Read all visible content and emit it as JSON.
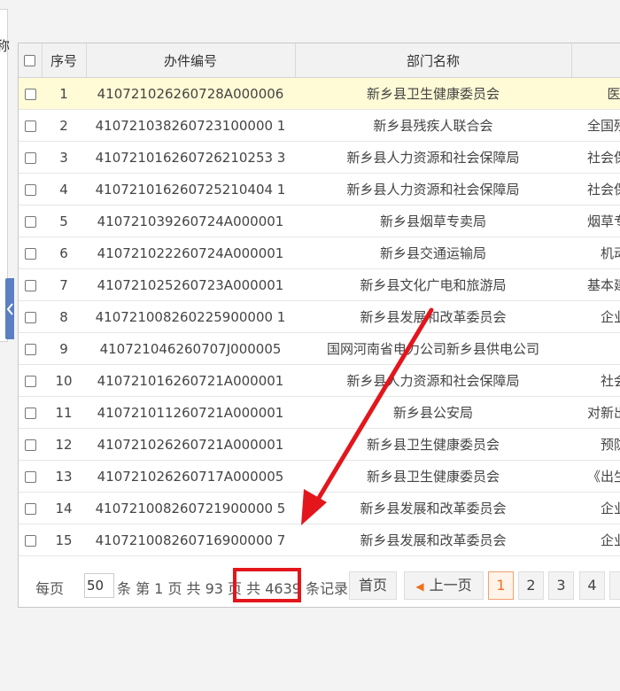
{
  "sidebar": {
    "cut_text": "称"
  },
  "grid": {
    "columns": [
      "序号",
      "办件编号",
      "部门名称"
    ],
    "rows": [
      {
        "no": "1",
        "id": "410721026260728A000006",
        "dept": "新乡县卫生健康委员会",
        "extra": "医"
      },
      {
        "no": "2",
        "id": "410721038260723100000 1",
        "dept": "新乡县残疾人联合会",
        "extra": "全国残疾"
      },
      {
        "no": "3",
        "id": "410721016260726210253 3",
        "dept": "新乡县人力资源和社会保障局",
        "extra": "社会保障"
      },
      {
        "no": "4",
        "id": "410721016260725210404 1",
        "dept": "新乡县人力资源和社会保障局",
        "extra": "社会保障"
      },
      {
        "no": "5",
        "id": "410721039260724A000001",
        "dept": "新乡县烟草专卖局",
        "extra": "烟草专卖"
      },
      {
        "no": "6",
        "id": "410721022260724A000001",
        "dept": "新乡县交通运输局",
        "extra": "机动"
      },
      {
        "no": "7",
        "id": "410721025260723A000001",
        "dept": "新乡县文化广电和旅游局",
        "extra": "基本建设"
      },
      {
        "no": "8",
        "id": "410721008260225900000 1",
        "dept": "新乡县发展和改革委员会",
        "extra": "企业"
      },
      {
        "no": "9",
        "id": "410721046260707J000005",
        "dept": "国网河南省电力公司新乡县供电公司",
        "extra": ""
      },
      {
        "no": "10",
        "id": "410721016260721A000001",
        "dept": "新乡县人力资源和社会保障局",
        "extra": "社会"
      },
      {
        "no": "11",
        "id": "410721011260721A000001",
        "dept": "新乡县公安局",
        "extra": "对新出生"
      },
      {
        "no": "12",
        "id": "410721026260721A000001",
        "dept": "新乡县卫生健康委员会",
        "extra": "预防"
      },
      {
        "no": "13",
        "id": "410721026260717A000005",
        "dept": "新乡县卫生健康委员会",
        "extra": "《出生医"
      },
      {
        "no": "14",
        "id": "410721008260721900000 5",
        "dept": "新乡县发展和改革委员会",
        "extra": "企业"
      },
      {
        "no": "15",
        "id": "410721008260716900000 7",
        "dept": "新乡县发展和改革委员会",
        "extra": "企业"
      }
    ]
  },
  "pager": {
    "per_page_label": "每页",
    "per_page_value": "50",
    "text_after_input": "条 第 1 页 共 93 页 共 4639 条记录",
    "first_label": "首页",
    "prev_label": "上一页",
    "pages": [
      "1",
      "2",
      "3",
      "4"
    ]
  },
  "colors": {
    "annotation": "#e3161c",
    "active_page": "#f07020",
    "highlight_row": "#fffbd6"
  }
}
